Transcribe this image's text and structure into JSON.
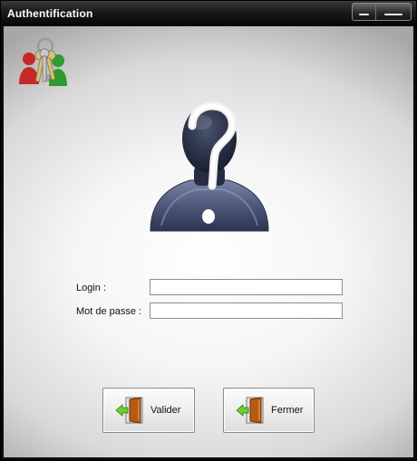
{
  "window": {
    "title": "Authentification"
  },
  "icons": {
    "app_icon": "keys-and-users-icon",
    "avatar": "unknown-user-question-mark-icon",
    "minimize": "minimize-icon",
    "close": "close-icon",
    "door": "exit-door-icon"
  },
  "form": {
    "login_label": "Login :",
    "login_value": "",
    "password_label": "Mot de passe :",
    "password_value": ""
  },
  "buttons": {
    "validate_label": "Valider",
    "close_label": "Fermer"
  },
  "colors": {
    "titlebar": "#050505",
    "title_text": "#ffffff",
    "avatar_body": "#5a6482",
    "door_arrow": "#6fcf2f"
  }
}
